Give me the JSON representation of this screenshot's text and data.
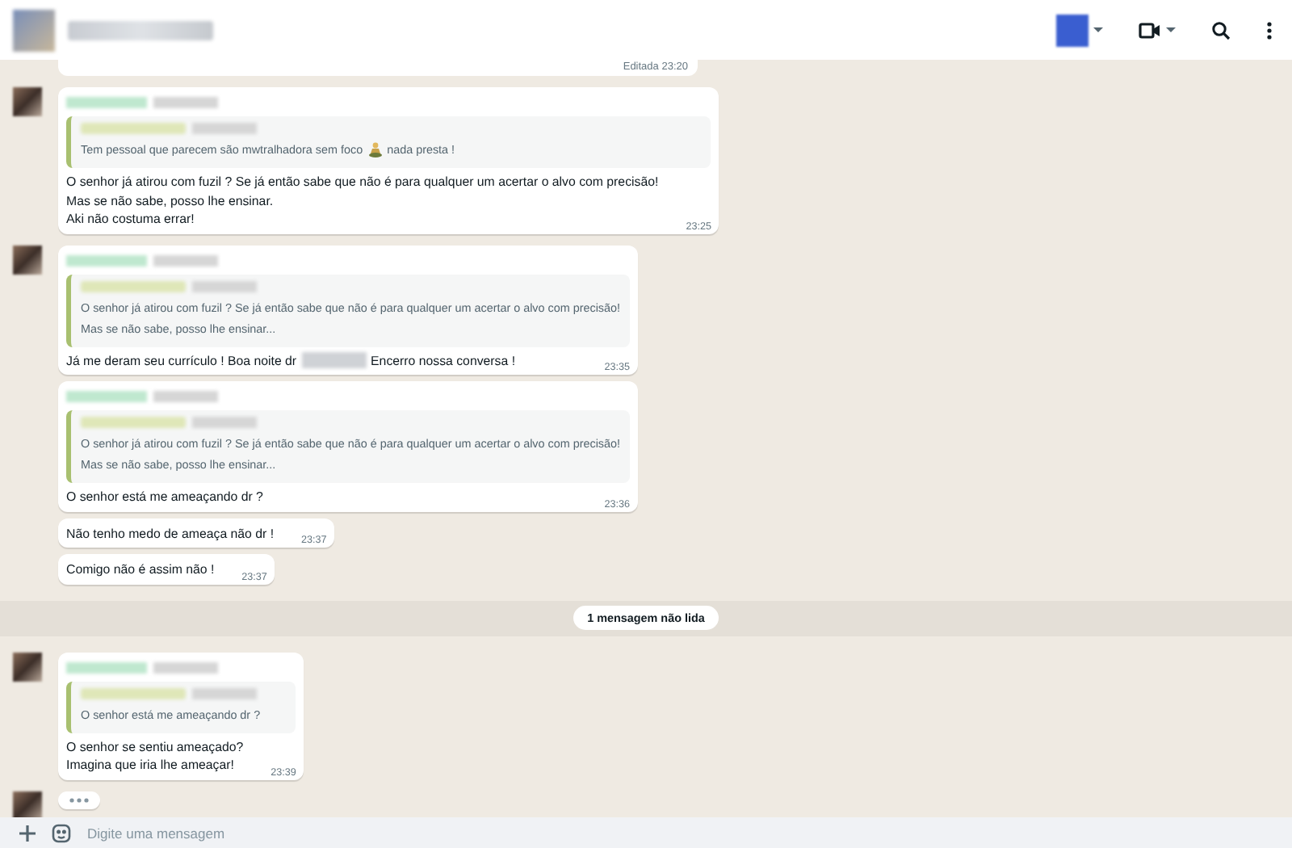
{
  "top_fragment": {
    "edited_label": "Editada",
    "time": "23:20"
  },
  "groups": [
    {
      "avatar": true,
      "messages": [
        {
          "show_sender": true,
          "quote": {
            "parts": [
              {
                "kind": "text",
                "text": "Tem pessoal que parecem são mwtralhadora sem foco"
              },
              {
                "kind": "figure"
              },
              {
                "kind": "text",
                "text": "nada presta !"
              }
            ]
          },
          "parts": [
            {
              "kind": "text",
              "text": "O senhor já atirou com fuzil ? Se já então sabe que não é para qualquer um acertar o alvo com precisão!\nMas se não sabe, posso lhe ensinar.\nAki não costuma errar!"
            }
          ],
          "time": "23:25"
        }
      ]
    },
    {
      "avatar": true,
      "messages": [
        {
          "show_sender": true,
          "quote": {
            "parts": [
              {
                "kind": "text",
                "text": "O senhor já atirou com fuzil ? Se já então sabe que não é para qualquer um acertar o alvo com precisão!\nMas se não sabe, posso lhe ensinar..."
              }
            ]
          },
          "parts": [
            {
              "kind": "text",
              "text": "Já me deram seu currículo ! Boa noite dr"
            },
            {
              "kind": "redacted"
            },
            {
              "kind": "text",
              "text": "Encerro nossa conversa !"
            }
          ],
          "time": "23:35"
        },
        {
          "show_sender": true,
          "quote": {
            "parts": [
              {
                "kind": "text",
                "text": "O senhor já atirou com fuzil ? Se já então sabe que não é para qualquer um acertar o alvo com precisão!\nMas se não sabe, posso lhe ensinar..."
              }
            ]
          },
          "parts": [
            {
              "kind": "text",
              "text": "O senhor está me ameaçando dr ?"
            }
          ],
          "time": "23:36"
        },
        {
          "show_sender": false,
          "parts": [
            {
              "kind": "text",
              "text": "Não tenho medo de ameaça não dr !"
            }
          ],
          "time": "23:37"
        },
        {
          "show_sender": false,
          "parts": [
            {
              "kind": "text",
              "text": "Comigo não é assim não !"
            }
          ],
          "time": "23:37"
        }
      ]
    },
    {
      "kind": "unread",
      "label": "1 mensagem não lida"
    },
    {
      "avatar": true,
      "messages": [
        {
          "show_sender": true,
          "quote": {
            "parts": [
              {
                "kind": "text",
                "text": "O senhor está me ameaçando dr ?"
              }
            ]
          },
          "parts": [
            {
              "kind": "text",
              "text": "O senhor se sentiu ameaçado?\nImagina que iria lhe ameaçar!"
            }
          ],
          "time": "23:39"
        }
      ]
    },
    {
      "kind": "typing",
      "avatar": true
    }
  ],
  "composer": {
    "placeholder": "Digite uma mensagem"
  }
}
